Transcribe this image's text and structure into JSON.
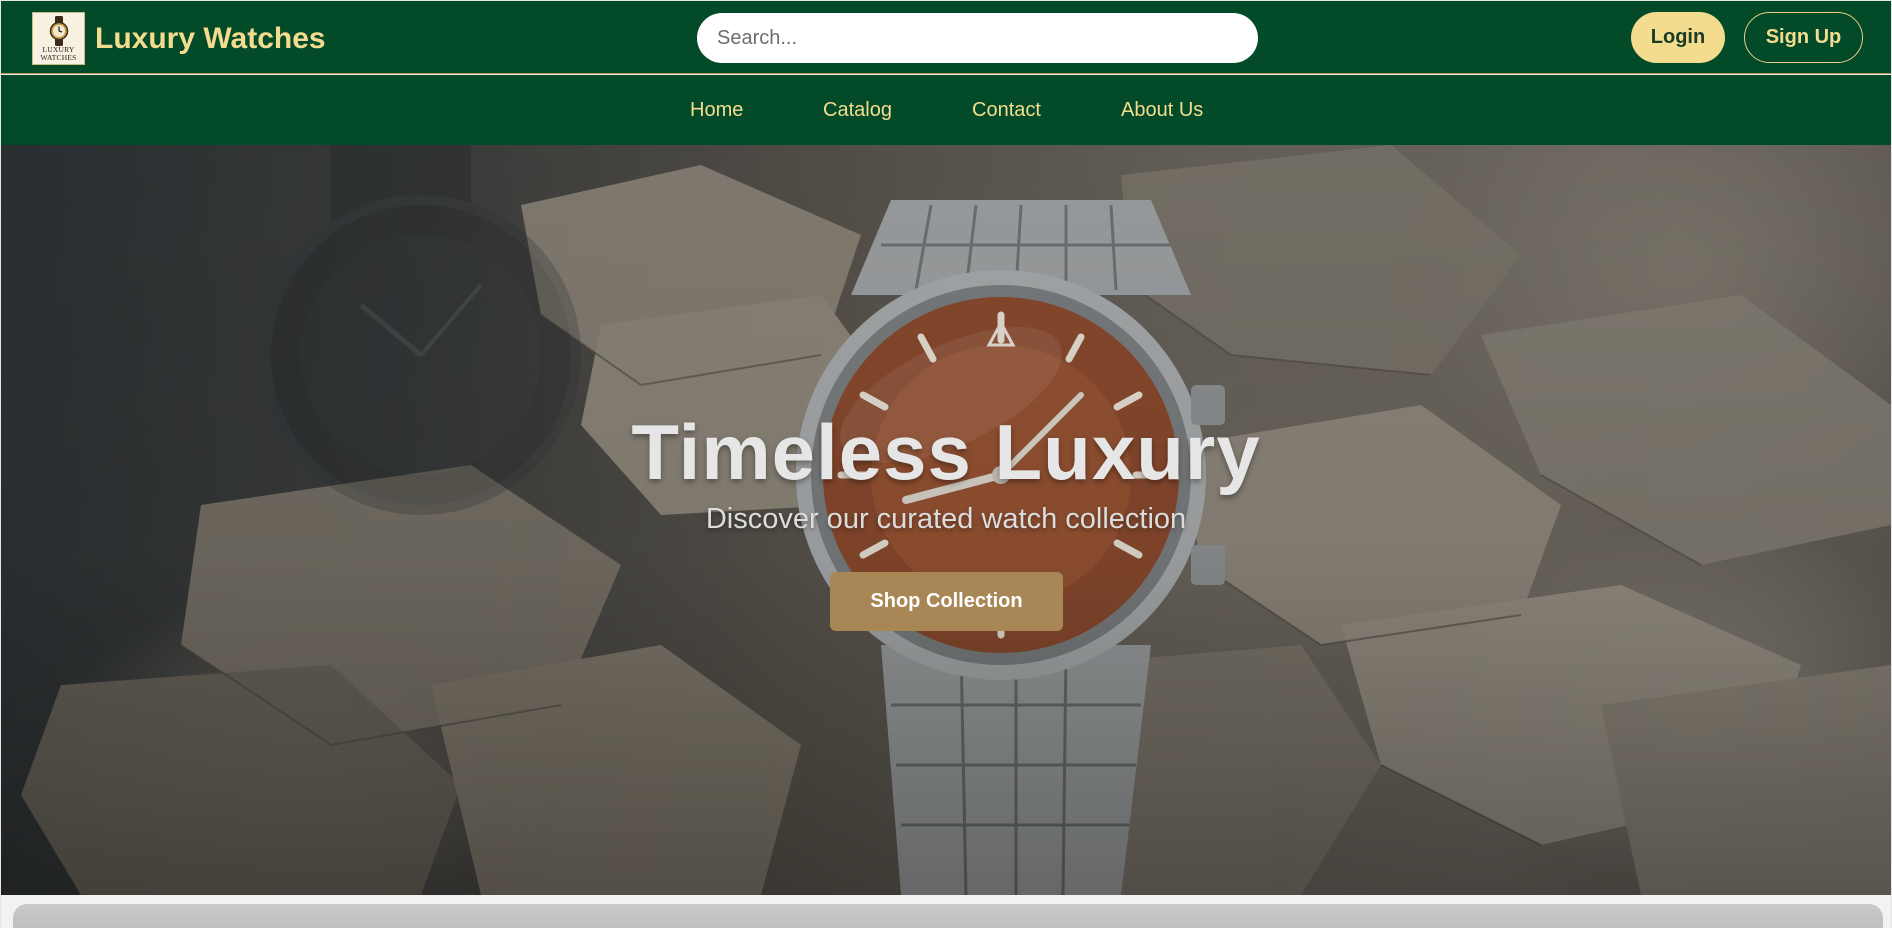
{
  "header": {
    "logo": {
      "text_line1": "LUXURY",
      "text_line2": "WATCHES",
      "icon": "wristwatch-icon"
    },
    "brand": "Luxury Watches",
    "search": {
      "placeholder": "Search...",
      "value": ""
    },
    "login_label": "Login",
    "signup_label": "Sign Up"
  },
  "nav": {
    "items": [
      {
        "label": "Home"
      },
      {
        "label": "Catalog"
      },
      {
        "label": "Contact"
      },
      {
        "label": "About Us"
      }
    ]
  },
  "hero": {
    "title": "Timeless Luxury",
    "subtitle": "Discover our curated watch collection",
    "cta_label": "Shop Collection",
    "image_subject": "steel wristwatch with copper dial resting on rocks"
  },
  "colors": {
    "header_bg": "#034a29",
    "accent_gold": "#f4dc8f",
    "cta_bg": "#a88655",
    "divider": "#b89a5d"
  }
}
